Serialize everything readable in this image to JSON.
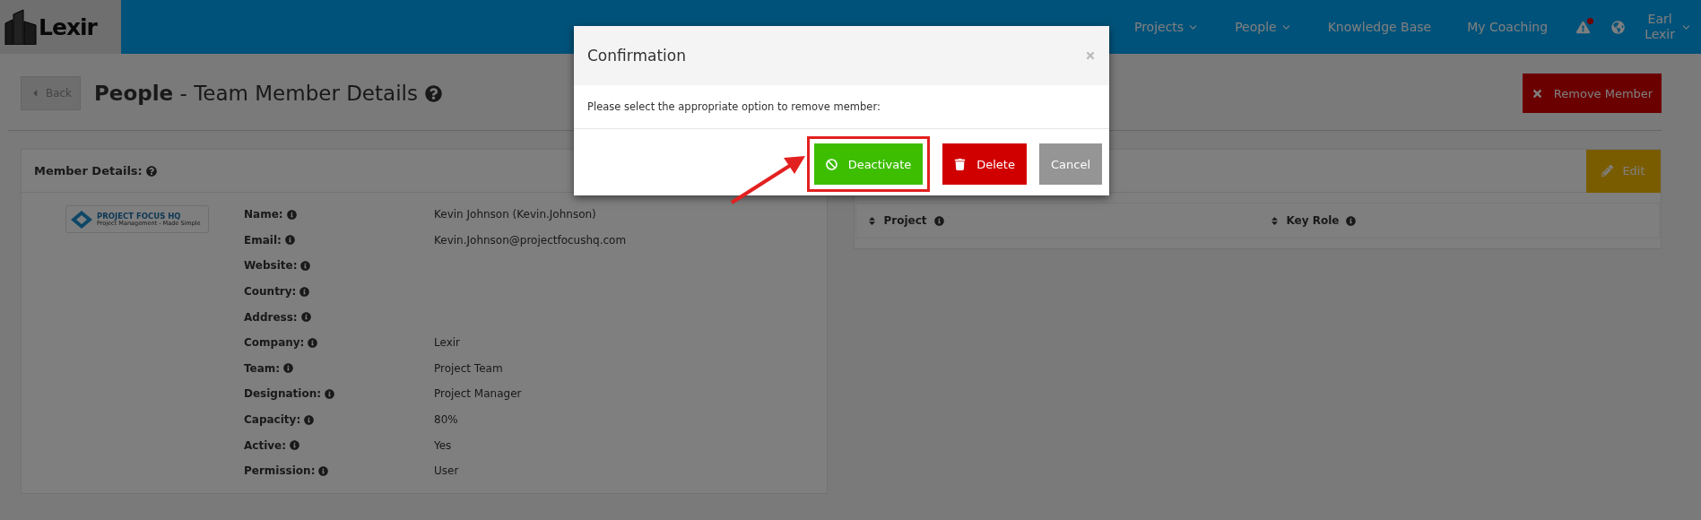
{
  "header": {
    "logo": "Lexir",
    "nav": [
      {
        "label": "Projects",
        "dropdown": true
      },
      {
        "label": "People",
        "dropdown": true
      },
      {
        "label": "Knowledge Base",
        "dropdown": false
      },
      {
        "label": "My Coaching",
        "dropdown": false
      }
    ],
    "alert_unread": true,
    "user": {
      "first_name": "Earl",
      "last_name": "Lexir"
    }
  },
  "page": {
    "back": "Back",
    "title_section": "People",
    "title_rest": " - Team Member Details",
    "remove_button": "Remove Member"
  },
  "member_card": {
    "title": "Member Details:",
    "company_logo": {
      "name": "PROJECT FOCUS",
      "suffix": "HQ",
      "tagline": "Project Management - Made Simple"
    },
    "fields": [
      {
        "label": "Name:",
        "value": "Kevin Johnson (Kevin.Johnson)"
      },
      {
        "label": "Email:",
        "value": "Kevin.Johnson@projectfocushq.com"
      },
      {
        "label": "Website:"
      },
      {
        "label": "Country:"
      },
      {
        "label": "Address:"
      },
      {
        "label": "Company:",
        "value": "Lexir"
      },
      {
        "label": "Team:",
        "value": "Project Team"
      },
      {
        "label": "Designation:",
        "value": "Project Manager"
      },
      {
        "label": "Capacity:",
        "value": "80%"
      },
      {
        "label": "Active:",
        "value": "Yes"
      },
      {
        "label": "Permission:",
        "value": "User"
      }
    ]
  },
  "projects_card": {
    "edit_button": "Edit",
    "columns": [
      "Project",
      "Key Role"
    ]
  },
  "dialog": {
    "title": "Confirmation",
    "message": "Please select the appropriate option to remove member:",
    "buttons": [
      {
        "label": "Deactivate",
        "kind": "deactivate",
        "highlighted": true
      },
      {
        "label": "Delete",
        "kind": "delete",
        "highlighted": false
      },
      {
        "label": "Cancel",
        "kind": "cancel",
        "highlighted": false
      }
    ]
  }
}
